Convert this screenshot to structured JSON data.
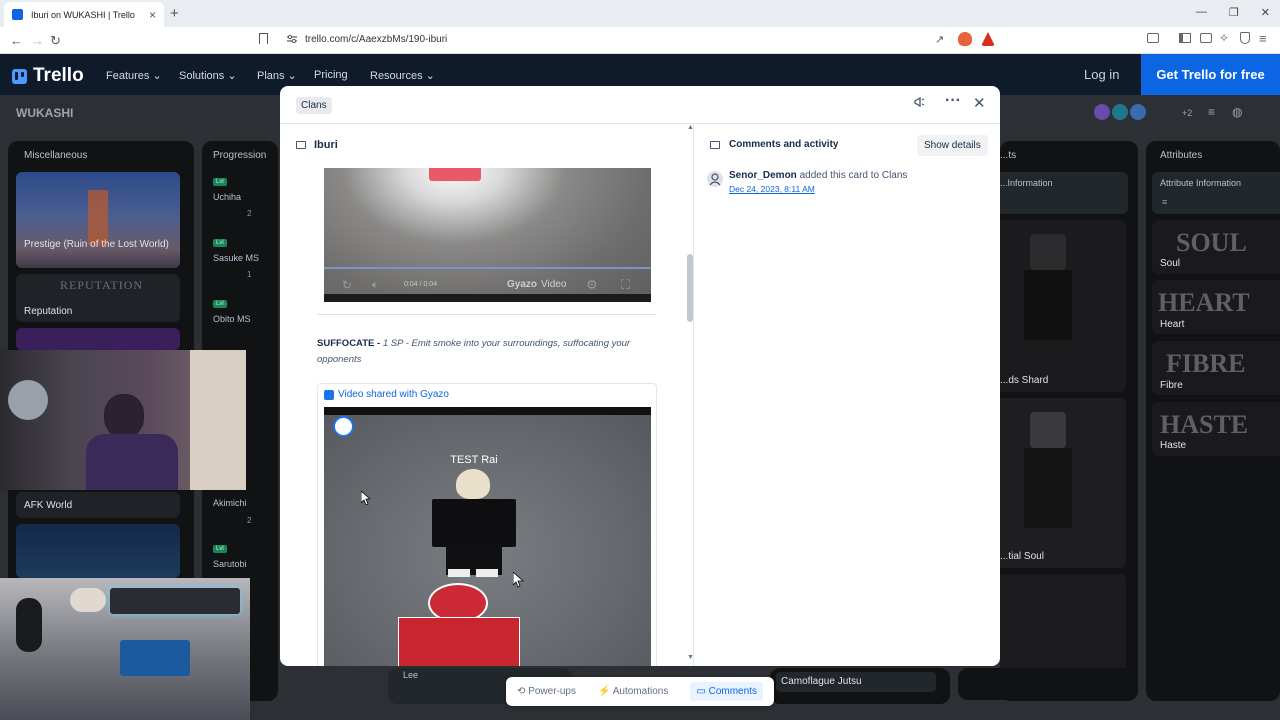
{
  "browser": {
    "tab_title": "Iburi on WUKASHI | Trello",
    "url": "trello.com/c/AaexzbMs/190-iburi",
    "new_tab": "+",
    "tab_close": "×"
  },
  "header": {
    "logo": "Trello",
    "nav": [
      "Features",
      "Solutions",
      "Plans",
      "Pricing",
      "Resources"
    ],
    "login": "Log in",
    "cta": "Get Trello for free"
  },
  "board": {
    "title": "WUKASHI",
    "members_more": "+2",
    "lists": {
      "misc": {
        "title": "Miscellaneous",
        "cards": [
          "Prestige (Ruin of the Lost World)",
          "REPUTATION",
          "Reputation",
          "AFK World"
        ]
      },
      "progression": {
        "title": "Progression",
        "tag": "Lvl",
        "cards": [
          "Uchiha",
          "Sasuke MS",
          "Obito MS",
          "Akimichi",
          "Sarutobi"
        ],
        "counts": [
          "2",
          "1",
          "2"
        ]
      },
      "middle": {
        "title": "...ts",
        "items": [
          "...Information",
          "...ds Shard",
          "...tial Soul"
        ]
      },
      "attributes": {
        "title": "Attributes",
        "info": "Attribute Information",
        "cards": [
          {
            "art": "SOUL",
            "label": "Soul"
          },
          {
            "art": "HEART",
            "label": "Heart"
          },
          {
            "art": "FIBRE",
            "label": "Fibre"
          },
          {
            "art": "HASTE",
            "label": "Haste"
          }
        ]
      },
      "bottom_cards": [
        "Lee",
        "Camoflague Jutsu"
      ]
    }
  },
  "modal": {
    "list_badge": "Clans",
    "card_title": "Iburi",
    "video1": {
      "time": "0:04 / 0:04",
      "brand": "Gyazo",
      "brand2": "Video",
      "progress": 1.0
    },
    "ability_name": "SUFFOCATE",
    "ability_sep": " - ",
    "ability_desc": "1 SP - Emit smoke into your surroundings, suffocating your opponents",
    "gyazo_link": "Video shared with Gyazo",
    "video2_caption": "TEST Rai",
    "comments_title": "Comments and activity",
    "show_details": "Show details",
    "activity": {
      "user": "Senor_Demon",
      "action": " added this card to Clans",
      "date": "Dec 24, 2023, 8:11 AM"
    }
  },
  "bottombar": {
    "powerups": "Power-ups",
    "automations": "Automations",
    "comments": "Comments"
  },
  "colors": {
    "brand": "#0c66e4",
    "board_bg": "#2c2f33",
    "header_bg": "#0f1a2b",
    "label_green": "#1f845a"
  }
}
